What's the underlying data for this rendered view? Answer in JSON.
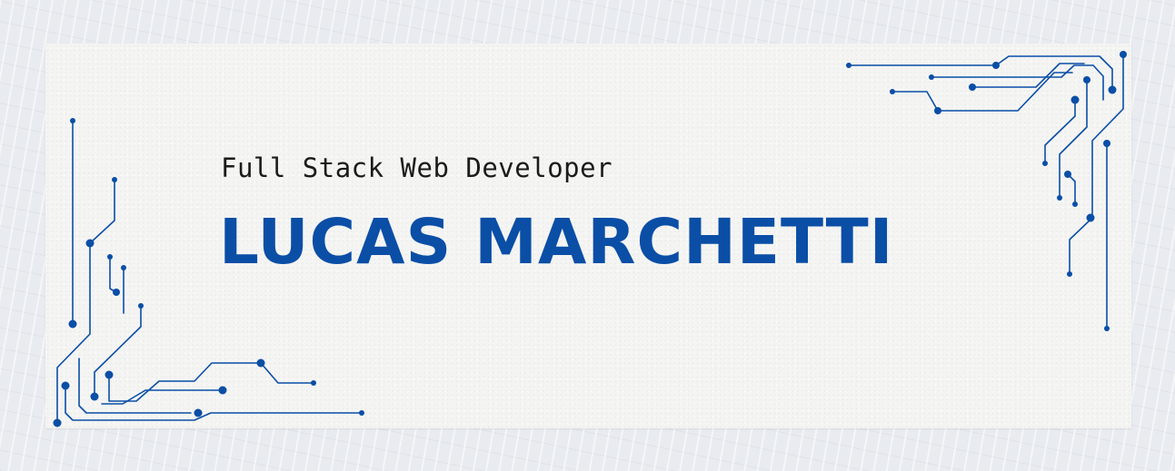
{
  "banner": {
    "subtitle": "Full Stack Web Developer",
    "name": "LUCAS MARCHETTI"
  },
  "colors": {
    "accent": "#0a4ea6",
    "card": "#f4f4f3",
    "background": "#e8ebef",
    "subtitle_text": "#1b1b1b"
  },
  "decorations": {
    "left": "circuit-board-traces",
    "right": "circuit-board-traces"
  }
}
